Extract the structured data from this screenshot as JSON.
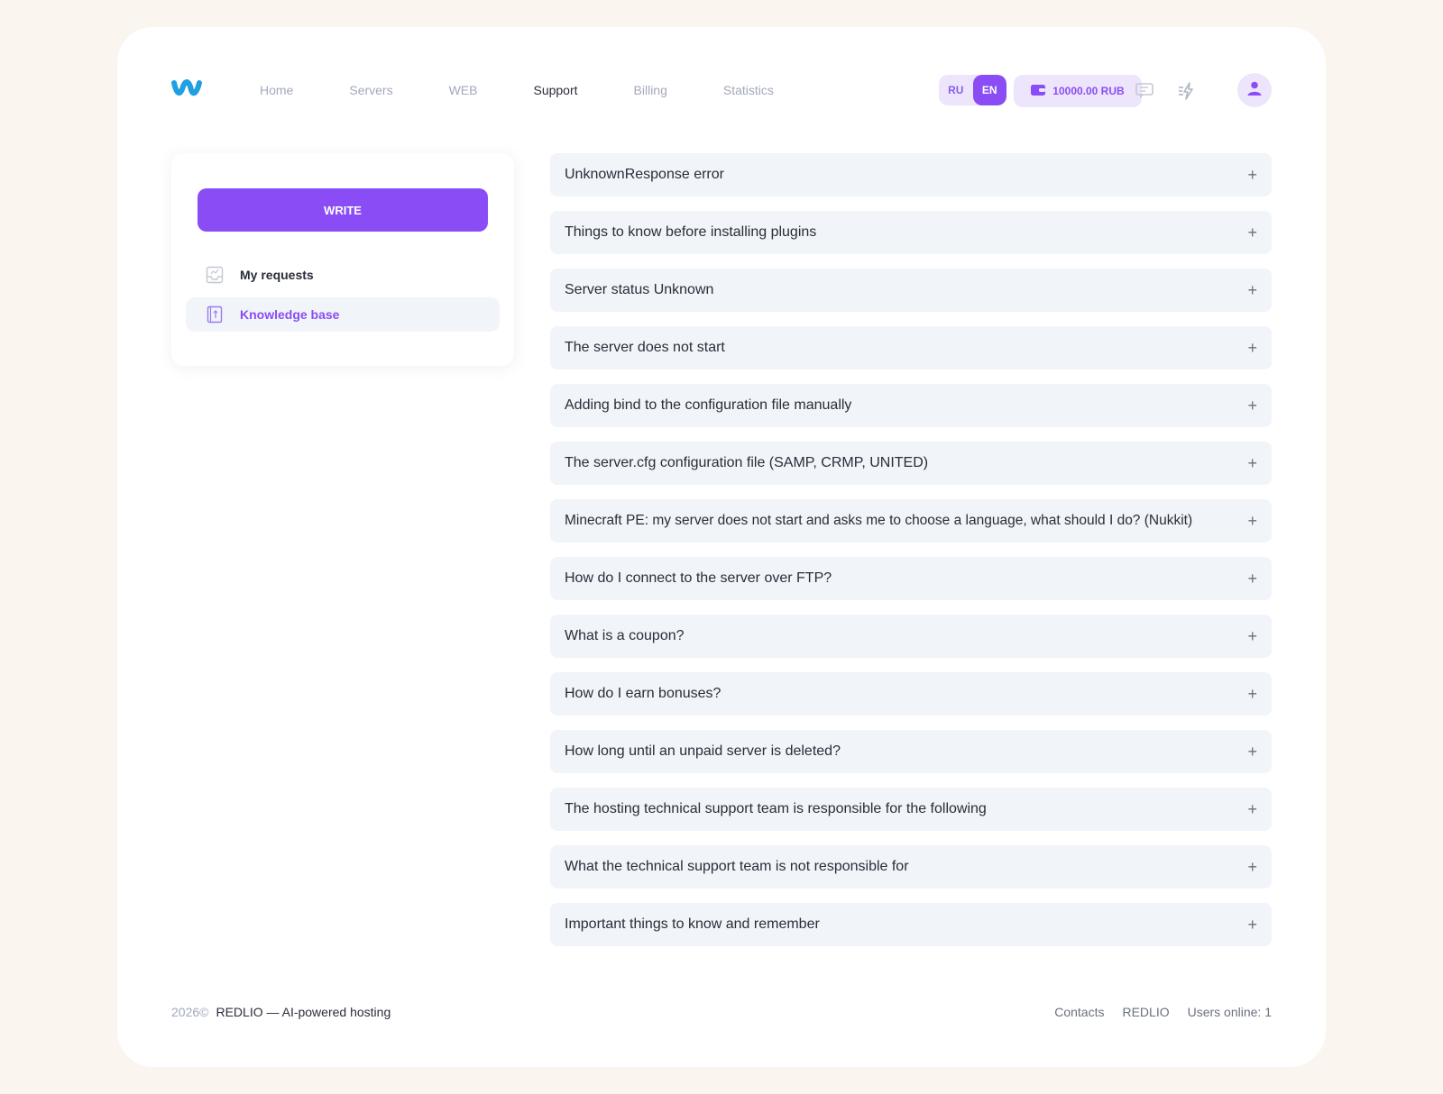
{
  "brand": {
    "accent": "#8a4df5",
    "logo_icon": "wave-logo-icon"
  },
  "nav": {
    "items": [
      {
        "label": "Home"
      },
      {
        "label": "Servers"
      },
      {
        "label": "WEB"
      },
      {
        "label": "Support"
      },
      {
        "label": "Billing"
      },
      {
        "label": "Statistics"
      }
    ],
    "active": "Support"
  },
  "header": {
    "lang_ru": "RU",
    "lang_en": "EN",
    "active_lang": "EN",
    "balance": "10000.00 RUB"
  },
  "sidebar": {
    "write_label": "WRITE",
    "items": [
      {
        "label": "My requests",
        "icon": "inbox-icon"
      },
      {
        "label": "Knowledge base",
        "icon": "book-icon"
      }
    ]
  },
  "faq": {
    "items": [
      "UnknownResponse error",
      "Things to know before installing plugins",
      "Server status Unknown",
      "The server does not start",
      "Adding bind to the configuration file manually",
      "The server.cfg configuration file (SAMP, CRMP, UNITED)",
      "Minecraft PE: my server does not start and asks me to choose a language, what should I do? (Nukkit)",
      "How do I connect to the server over FTP?",
      "What is a coupon?",
      "How do I earn bonuses?",
      "How long until an unpaid server is deleted?",
      "The hosting technical support team is responsible for the following",
      "What the technical support team is not responsible for",
      "Important things to know and remember"
    ],
    "expand_symbol": "+"
  },
  "footer": {
    "year": "2026©",
    "tagline": "REDLIO — AI-powered hosting",
    "links": [
      "Contacts",
      "REDLIO"
    ],
    "users_online": "Users online: 1"
  }
}
